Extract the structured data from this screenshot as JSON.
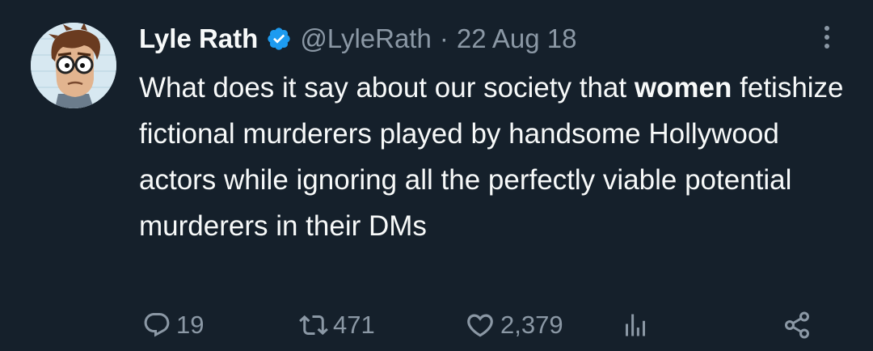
{
  "author": {
    "display_name": "Lyle Rath",
    "handle": "@LyleRath",
    "verified": true,
    "avatar_icon": "cartoon-avatar"
  },
  "timestamp": "22 Aug 18",
  "separator": "·",
  "tweet": {
    "segments": [
      {
        "text": "What does it say about our society that ",
        "bold": false
      },
      {
        "text": "women",
        "bold": true
      },
      {
        "text": " fetishize fictional murderers played by handsome Hollywood actors while ignoring all the perfectly viable potential murderers in their DMs",
        "bold": false
      }
    ]
  },
  "actions": {
    "replies": "19",
    "retweets": "471",
    "likes": "2,379"
  },
  "icons": {
    "reply": "reply-icon",
    "retweet": "retweet-icon",
    "like": "heart-icon",
    "views": "analytics-icon",
    "share": "share-icon",
    "more": "more-options-icon",
    "verified": "verified-badge-icon"
  },
  "colors": {
    "background": "#15202b",
    "text_primary": "#f7f9f9",
    "text_secondary": "#8b98a5",
    "verified_blue": "#1d9bf0"
  }
}
